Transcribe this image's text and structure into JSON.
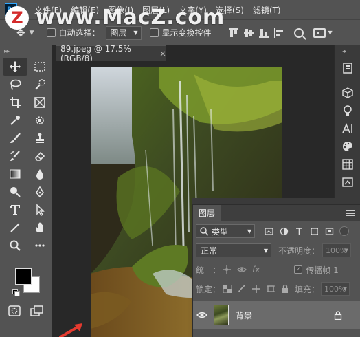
{
  "app": {
    "logo": "Ps"
  },
  "menu": [
    "文件(F)",
    "编辑(E)",
    "图像(I)",
    "图层(L)",
    "文字(Y)",
    "选择(S)",
    "滤镜(T)"
  ],
  "watermark": {
    "logo": "Z",
    "text": "www.MacZ.com"
  },
  "options": {
    "auto_select_label": "自动选择：",
    "auto_select_value": "图层",
    "show_transform_label": "显示变换控件"
  },
  "document": {
    "tab_title": "89.jpeg @ 17.5%(RGB/8)",
    "close": "×"
  },
  "layers_panel": {
    "title": "图层",
    "filter_kind": "类型",
    "blend_mode": "正常",
    "opacity_label": "不透明度：",
    "opacity_value": "100%",
    "unify_label": "统一：",
    "propagate_label": "传播帧 1",
    "lock_label": "锁定：",
    "fill_label": "填充：",
    "fill_value": "100%",
    "layer_name": "背景"
  },
  "colors": {
    "foreground": "#000000",
    "background": "#ffffff",
    "accent": "#31a8ff",
    "arrow": "#e53a2f"
  },
  "tool_icons": [
    "move-tool",
    "marquee-tool",
    "lasso-tool",
    "quick-select-tool",
    "crop-tool",
    "frame-tool",
    "eyedropper-tool",
    "healing-tool",
    "brush-tool",
    "stamp-tool",
    "history-brush-tool",
    "eraser-tool",
    "gradient-tool",
    "blur-tool",
    "dodge-tool",
    "pen-tool",
    "type-tool",
    "path-select-tool",
    "line-tool",
    "hand-tool",
    "zoom-tool",
    "more-tools"
  ]
}
